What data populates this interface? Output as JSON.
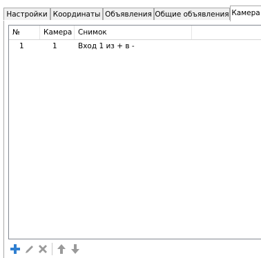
{
  "tabs": [
    {
      "label": "Настройки",
      "active": false
    },
    {
      "label": "Координаты",
      "active": false
    },
    {
      "label": "Объявления",
      "active": false
    },
    {
      "label": "Общие объявления",
      "active": false
    },
    {
      "label": "Камера",
      "active": true
    }
  ],
  "table": {
    "columns": [
      "№",
      "Камера",
      "Снимок"
    ],
    "rows": [
      {
        "num": "1",
        "camera": "1",
        "snapshot": "Вход 1 из + в -"
      }
    ]
  },
  "toolbar": {
    "buttons": [
      {
        "icon": "plus-icon",
        "enabled": true,
        "color": "#2f7fd0"
      },
      {
        "icon": "edit-icon",
        "enabled": false,
        "color": "#9a9a9a"
      },
      {
        "icon": "delete-icon",
        "enabled": false,
        "color": "#9a9a9a"
      },
      {
        "icon": "arrow-up-icon",
        "enabled": false,
        "color": "#9a9a9a"
      },
      {
        "icon": "arrow-down-icon",
        "enabled": false,
        "color": "#9a9a9a"
      }
    ]
  }
}
